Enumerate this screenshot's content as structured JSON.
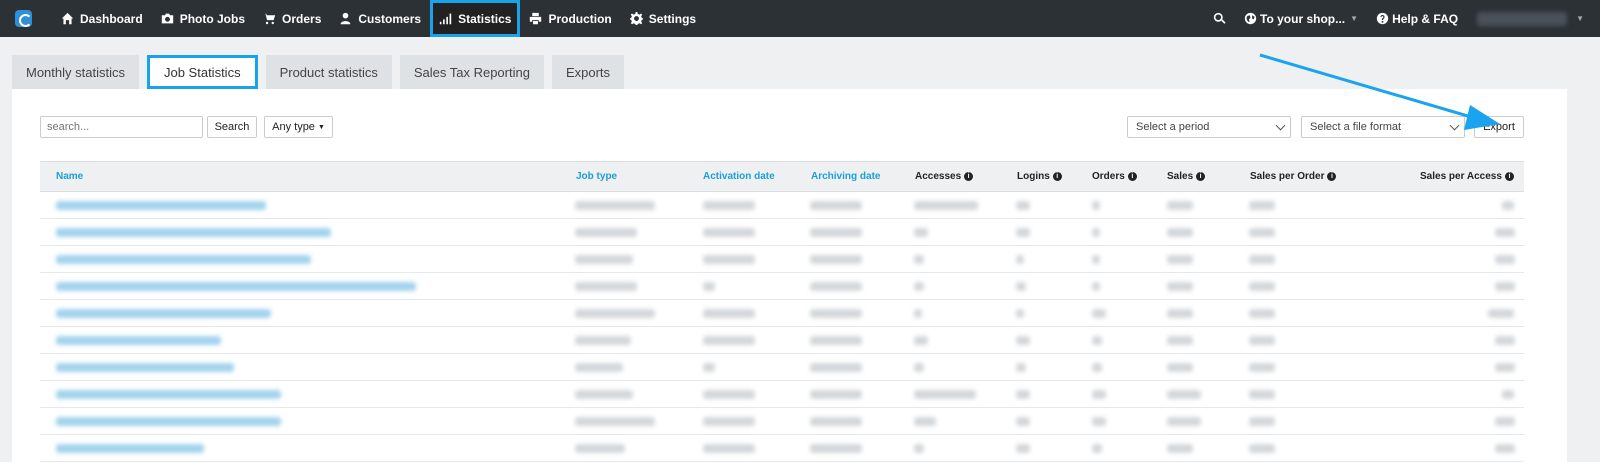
{
  "nav": {
    "items": [
      {
        "label": "Dashboard",
        "icon": "home-icon",
        "active": false
      },
      {
        "label": "Photo Jobs",
        "icon": "camera-icon",
        "active": false
      },
      {
        "label": "Orders",
        "icon": "cart-icon",
        "active": false
      },
      {
        "label": "Customers",
        "icon": "user-icon",
        "active": false
      },
      {
        "label": "Statistics",
        "icon": "bar-chart-icon",
        "active": true
      },
      {
        "label": "Production",
        "icon": "printer-icon",
        "active": false
      },
      {
        "label": "Settings",
        "icon": "gear-icon",
        "active": false
      }
    ],
    "shop_label": "To your shop...",
    "help_label": "Help & FAQ"
  },
  "tabs": [
    {
      "label": "Monthly statistics",
      "active": false
    },
    {
      "label": "Job Statistics",
      "active": true
    },
    {
      "label": "Product statistics",
      "active": false
    },
    {
      "label": "Sales Tax Reporting",
      "active": false
    },
    {
      "label": "Exports",
      "active": false
    }
  ],
  "toolbar": {
    "search_placeholder": "search...",
    "search_button": "Search",
    "type_filter": "Any type",
    "period_select": "Select a period",
    "format_select": "Select a file format",
    "export_button": "Export"
  },
  "table": {
    "columns": [
      {
        "label": "Name",
        "sortable": true,
        "info": false
      },
      {
        "label": "Job type",
        "sortable": true,
        "info": false
      },
      {
        "label": "Activation date",
        "sortable": true,
        "info": false
      },
      {
        "label": "Archiving date",
        "sortable": true,
        "info": false
      },
      {
        "label": "Accesses",
        "sortable": false,
        "info": true
      },
      {
        "label": "Logins",
        "sortable": false,
        "info": true
      },
      {
        "label": "Orders",
        "sortable": false,
        "info": true
      },
      {
        "label": "Sales",
        "sortable": false,
        "info": true
      },
      {
        "label": "Sales per Order",
        "sortable": false,
        "info": true
      },
      {
        "label": "Sales per Access",
        "sortable": false,
        "info": true
      }
    ],
    "row_count": 10
  },
  "colors": {
    "nav_bg": "#2c3136",
    "accent": "#19a3ea",
    "link": "#1b9fd9"
  }
}
